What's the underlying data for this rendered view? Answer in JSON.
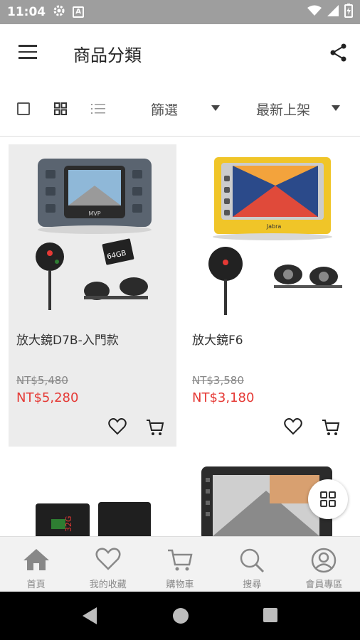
{
  "status_bar": {
    "time": "11:04",
    "notification_letter": "A"
  },
  "app_bar": {
    "title": "商品分類"
  },
  "toolbar": {
    "filter_label": "篩選",
    "sort_label": "最新上架"
  },
  "products": [
    {
      "name": "放大鏡D7B-入門款",
      "old_price": "NT$5,480",
      "price": "NT$5,280",
      "screen_label": "MVP",
      "sd_card_label": "64GB"
    },
    {
      "name": "放大鏡F6",
      "old_price": "NT$3,580",
      "price": "NT$3,180",
      "screen_label": "Jabra"
    }
  ],
  "partial_products": [
    {
      "card_label": "32G"
    },
    {
      "card_label": ""
    }
  ],
  "bottom_nav": [
    {
      "label": "首頁",
      "icon": "home-icon"
    },
    {
      "label": "我的收藏",
      "icon": "heart-icon"
    },
    {
      "label": "購物車",
      "icon": "cart-icon"
    },
    {
      "label": "搜尋",
      "icon": "search-icon"
    },
    {
      "label": "會員專區",
      "icon": "user-icon"
    }
  ],
  "colors": {
    "price_red": "#e53935",
    "status_bar": "#9e9e9e",
    "nav_active": "#888888",
    "selected_card_bg": "#ececec"
  }
}
